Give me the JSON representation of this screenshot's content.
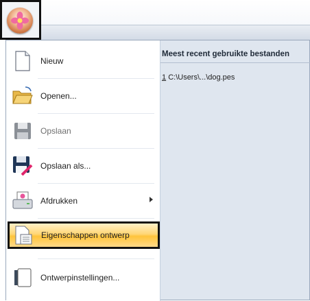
{
  "app": {
    "orb_icon": "flower-orb-icon"
  },
  "menu": {
    "commands": [
      {
        "label": "Nieuw",
        "icon": "new-document-icon"
      },
      {
        "label": "Openen...",
        "icon": "open-folder-icon"
      },
      {
        "label": "Opslaan",
        "icon": "save-disk-icon"
      },
      {
        "label": "Opslaan als...",
        "icon": "save-as-icon"
      },
      {
        "label": "Afdrukken",
        "icon": "print-icon"
      },
      {
        "label": "Eigenschappen ontwerp",
        "icon": "design-properties-icon",
        "selected": true
      },
      {
        "label": "Ontwerpinstellingen...",
        "icon": "design-settings-icon"
      }
    ],
    "recent": {
      "title": "Meest recent gebruikte bestanden",
      "items": [
        {
          "index": "1",
          "path": "C:\\Users\\...\\dog.pes"
        }
      ]
    }
  },
  "colors": {
    "highlight": "#ffd676",
    "recent_pane": "#dfe6ef"
  }
}
